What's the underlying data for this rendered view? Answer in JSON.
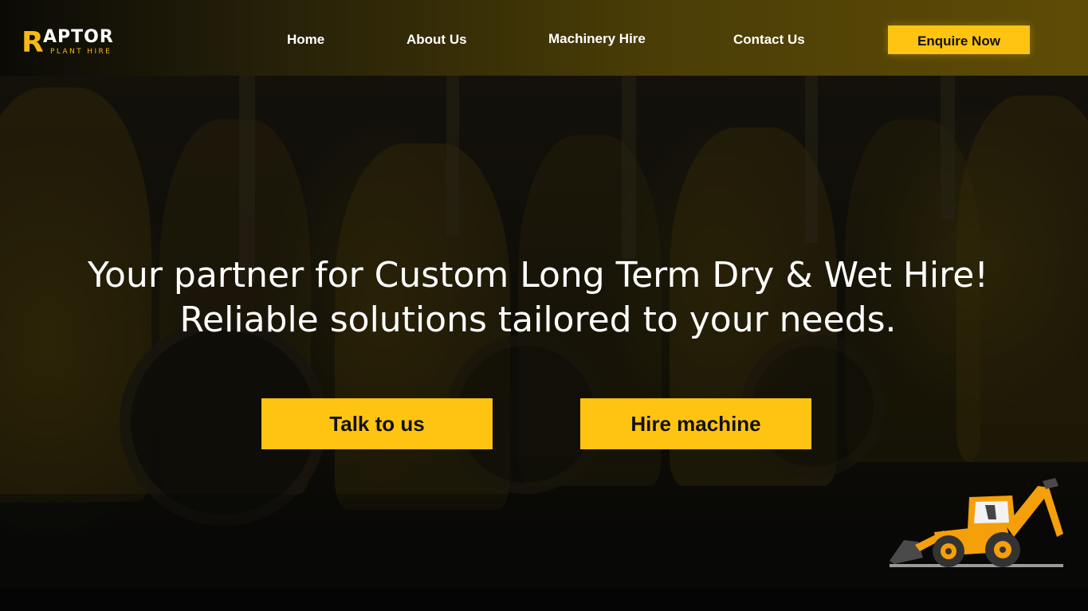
{
  "brand": {
    "logo_mark": "R",
    "logo_word": "APTOR",
    "logo_sub": "PLANT HIRE",
    "accent_color": "#ffc412"
  },
  "nav": {
    "items": [
      {
        "label": "Home"
      },
      {
        "label": "About Us"
      },
      {
        "label": "Machinery Hire"
      },
      {
        "label": "Contact Us"
      }
    ],
    "cta_label": "Enquire Now"
  },
  "hero": {
    "headline_line1": "Your partner for Custom Long Term Dry & Wet Hire!",
    "headline_line2": "Reliable solutions tailored to your needs.",
    "buttons": [
      {
        "label": "Talk to us"
      },
      {
        "label": "Hire machine"
      }
    ],
    "illustration_icon": "backhoe-loader-icon"
  }
}
